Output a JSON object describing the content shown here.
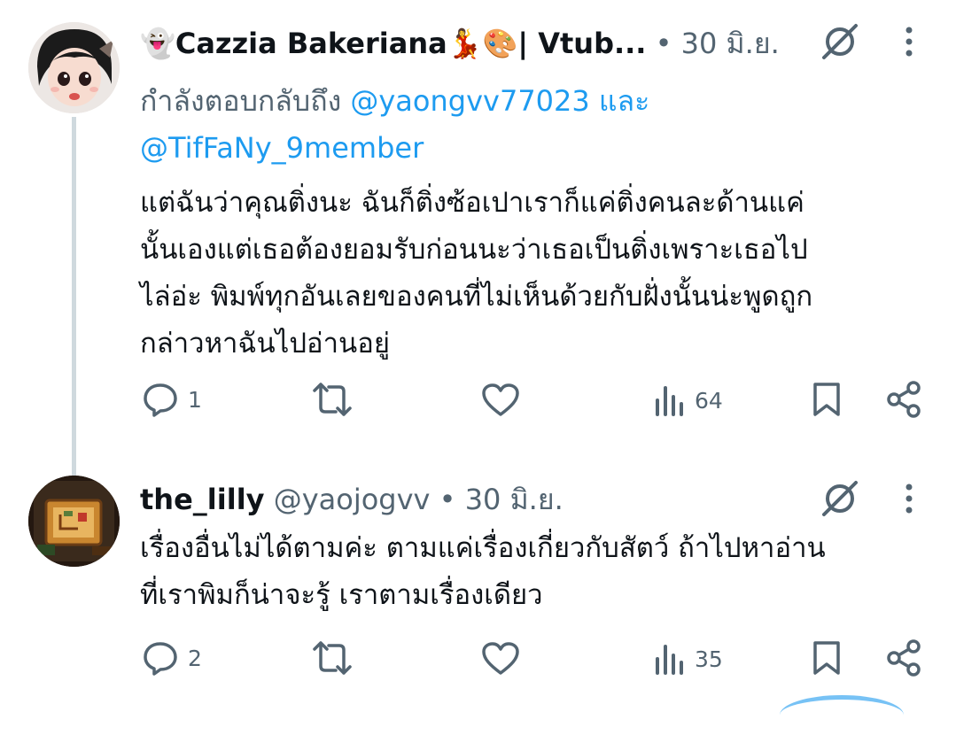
{
  "tweets": [
    {
      "display_name": "👻Cazzia Bakeriana💃🎨| Vtub...",
      "separator": "•",
      "time": "30 มิ.ย.",
      "replying_prefix": "กำลังตอบกลับถึง",
      "replying_mention_1": "@yaongvv77023",
      "replying_and": "และ",
      "replying_mention_2": "@TifFaNy_9member",
      "text_lines": [
        "แต่ฉันว่าคุณติ่งนะ ฉันก็ติ่งซ้อเปาเราก็แค่ติ่งคนละด้านแค่",
        "นั้นเองแต่เธอต้องยอมรับก่อนนะว่าเธอเป็นติ่งเพราะเธอไป",
        "ไล่อ่ะ พิมพ์ทุกอันเลยของคนที่ไม่เห็นด้วยกับฝั่งนั้นน่ะพูดถูก",
        "กล่าวหาฉันไปอ่านอยู่"
      ],
      "replies": "1",
      "views": "64"
    },
    {
      "display_name": "the_lilly",
      "handle": "@yaojogvv",
      "separator": "•",
      "time": "30 มิ.ย.",
      "text_lines": [
        "เรื่องอื่นไม่ได้ตามค่ะ ตามแค่เรื่องเกี่ยวกับสัตว์ ถ้าไปหาอ่าน",
        "ที่เราพิมก็น่าจะรู้ เราตามเรื่องเดียว"
      ],
      "replies": "2",
      "views": "35"
    }
  ],
  "icons": {
    "reply": "reply-icon",
    "retweet": "retweet-icon",
    "like": "like-icon",
    "views": "views-icon",
    "bookmark": "bookmark-icon",
    "share": "share-icon",
    "grok": "grok-icon",
    "more": "more-icon"
  },
  "colors": {
    "text": "#0f1419",
    "secondary": "#536471",
    "link": "#1d9bf0",
    "thread_line": "#cfd9de"
  }
}
